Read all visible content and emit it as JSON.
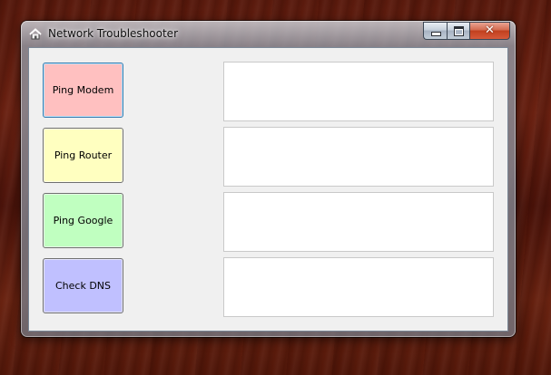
{
  "window": {
    "title": "Network Troubleshooter",
    "icon": "home-network-icon",
    "caption_buttons": [
      "minimize-icon",
      "maximize-icon",
      "close-icon"
    ],
    "close_glyph": "✕"
  },
  "buttons": [
    {
      "label": "Ping Modem",
      "color": "#ffc0c0"
    },
    {
      "label": "Ping Router",
      "color": "#ffffc0"
    },
    {
      "label": "Ping Google",
      "color": "#c0ffc0"
    },
    {
      "label": "Check DNS",
      "color": "#c0c0ff"
    }
  ],
  "outputs": [
    "",
    "",
    "",
    ""
  ],
  "colors": {
    "client_background": "#f0f0f0",
    "output_background": "#ffffff",
    "focus_border": "#3c7fb1"
  }
}
